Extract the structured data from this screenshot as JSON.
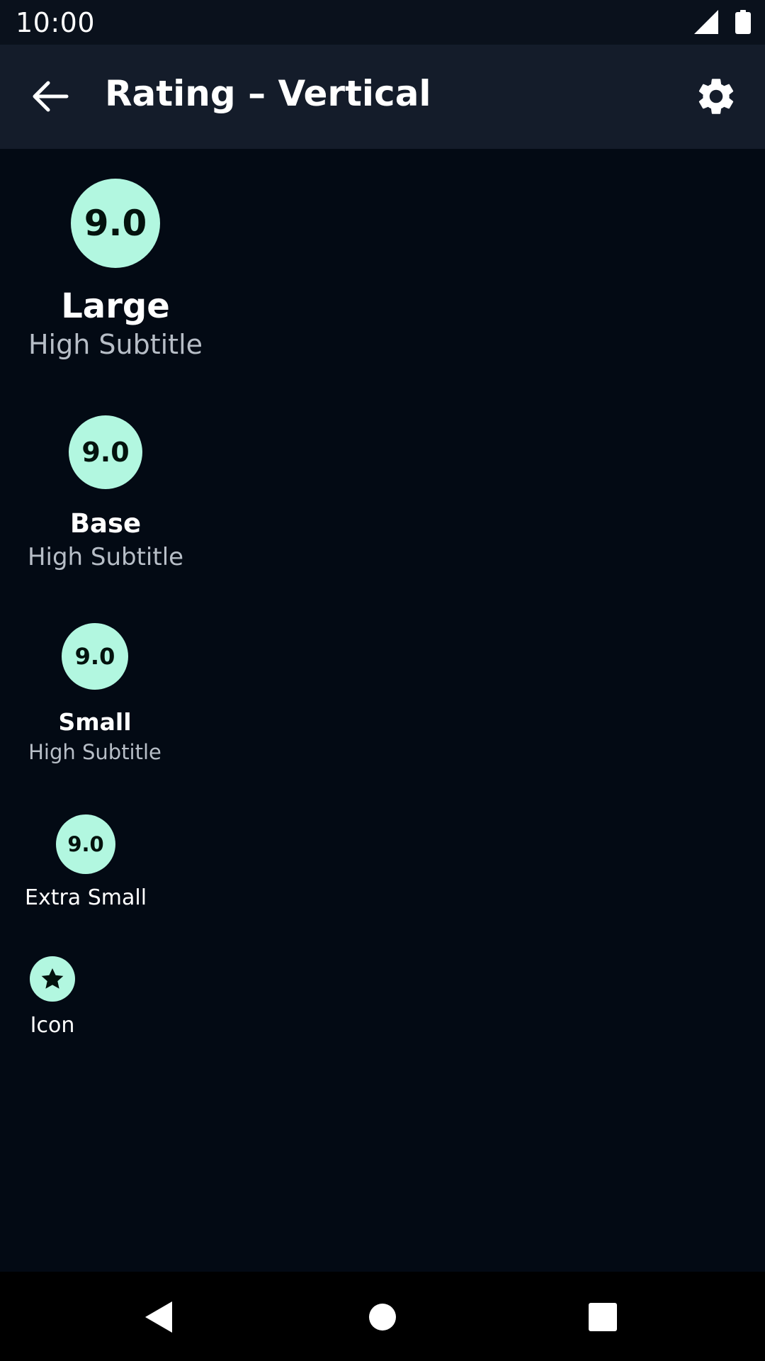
{
  "status_bar": {
    "time": "10:00",
    "icons": [
      "signal-icon",
      "battery-icon"
    ]
  },
  "app_bar": {
    "title": "Rating – Vertical",
    "back_icon": "arrow-back-icon",
    "settings_icon": "gear-icon"
  },
  "ratings": {
    "large": {
      "value": "9.0",
      "label": "Large",
      "subtitle": "High Subtitle"
    },
    "base": {
      "value": "9.0",
      "label": "Base",
      "subtitle": "High Subtitle"
    },
    "small": {
      "value": "9.0",
      "label": "Small",
      "subtitle": "High Subtitle"
    },
    "extra_small": {
      "value": "9.0",
      "label": "Extra Small"
    },
    "icon": {
      "icon": "star-icon",
      "label": "Icon"
    }
  },
  "nav_bar": {
    "back": "nav-back-icon",
    "home": "nav-home-icon",
    "recents": "nav-recents-icon"
  },
  "colors": {
    "background": "#030a14",
    "app_bar": "#141c2a",
    "badge": "#b2f7e0",
    "subtitle": "#b7bec7"
  }
}
